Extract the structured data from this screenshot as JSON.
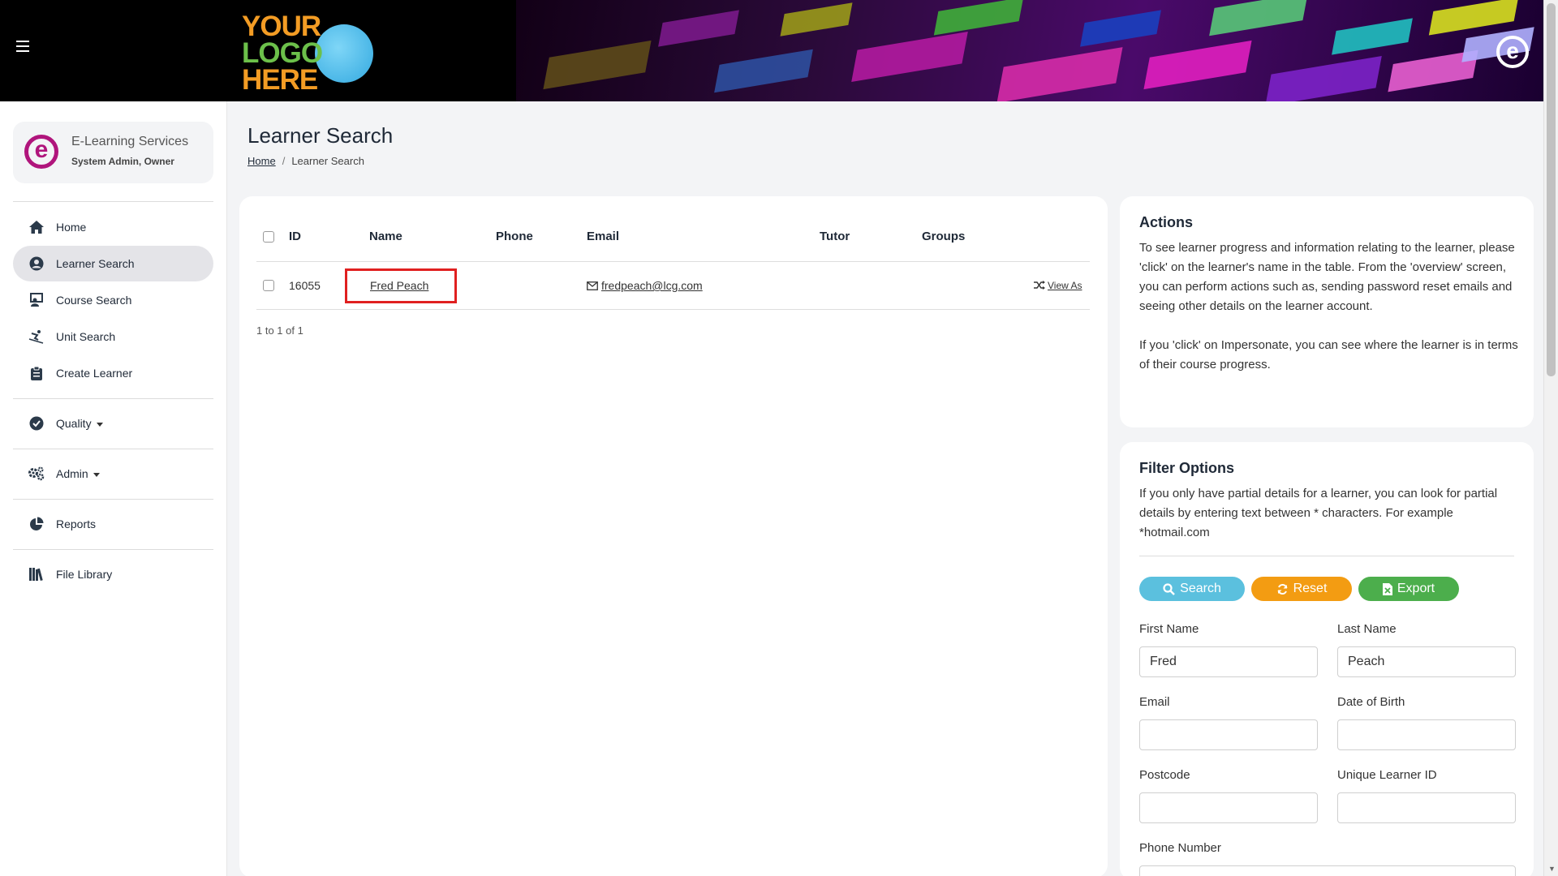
{
  "header": {
    "logo_line1": "YOUR",
    "logo_line2": "LOGO",
    "logo_line3": "HERE",
    "brand_icon": "e-brand-icon"
  },
  "sidebar": {
    "org_name": "E-Learning Services",
    "org_role": "System Admin, Owner",
    "items": [
      {
        "label": "Home",
        "icon": "home-icon"
      },
      {
        "label": "Learner Search",
        "icon": "user-circle-icon",
        "active": true
      },
      {
        "label": "Course Search",
        "icon": "teacher-icon"
      },
      {
        "label": "Unit Search",
        "icon": "skier-icon"
      },
      {
        "label": "Create Learner",
        "icon": "clipboard-icon"
      },
      {
        "label": "Quality",
        "icon": "check-circle-icon",
        "dropdown": true
      },
      {
        "label": "Admin",
        "icon": "cogs-icon",
        "dropdown": true
      },
      {
        "label": "Reports",
        "icon": "pie-chart-icon"
      },
      {
        "label": "File Library",
        "icon": "books-icon"
      }
    ]
  },
  "page": {
    "title": "Learner Search",
    "breadcrumb_home": "Home",
    "breadcrumb_current": "Learner Search",
    "breadcrumb_sep": "/"
  },
  "table": {
    "columns": [
      "ID",
      "Name",
      "Phone",
      "Email",
      "Tutor",
      "Groups"
    ],
    "rows": [
      {
        "id": "16055",
        "name": "Fred Peach",
        "phone": "",
        "email": "fredpeach@lcg.com",
        "tutor": "",
        "groups": "",
        "action": "View As"
      }
    ],
    "pager": "1 to 1 of 1"
  },
  "actions_card": {
    "title": "Actions",
    "text1": "To see learner progress and information relating to the learner, please 'click' on the learner's name in the table. From the 'overview' screen, you can perform actions such as, sending password reset emails and seeing other details on the learner account.",
    "text2": "If you 'click' on Impersonate, you can see where the learner is in terms of their course progress."
  },
  "filter_card": {
    "title": "Filter Options",
    "text": "If you only have partial details for a learner, you can look for partial details by entering text between * characters. For example *hotmail.com",
    "buttons": {
      "search": "Search",
      "reset": "Reset",
      "export": "Export"
    },
    "colors": {
      "search": "#5bc0de",
      "reset": "#f39c12",
      "export": "#4cae4c"
    },
    "fields": {
      "first_name_label": "First Name",
      "first_name_value": "Fred",
      "last_name_label": "Last Name",
      "last_name_value": "Peach",
      "email_label": "Email",
      "email_value": "",
      "dob_label": "Date of Birth",
      "dob_value": "",
      "postcode_label": "Postcode",
      "postcode_value": "",
      "uln_label": "Unique Learner ID",
      "uln_value": "",
      "phone_label": "Phone Number",
      "phone_value": ""
    }
  }
}
